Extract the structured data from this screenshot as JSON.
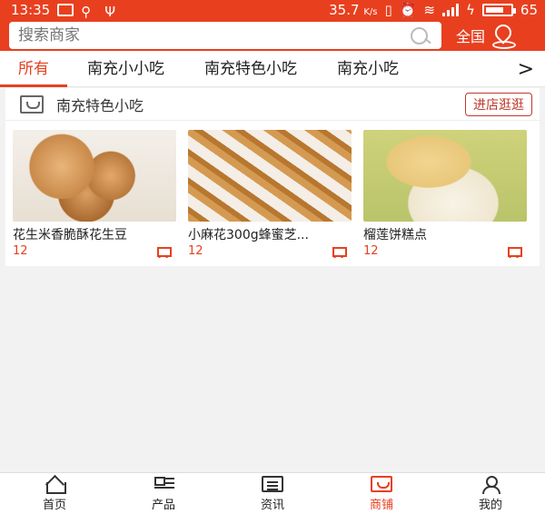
{
  "status_bar": {
    "time": "13:35",
    "speed": "35.7",
    "speed_unit": "K/s",
    "battery": "65"
  },
  "search": {
    "placeholder": "搜索商家",
    "region_label": "全国"
  },
  "tabs": [
    {
      "label": "所有",
      "active": true
    },
    {
      "label": "南充小小吃",
      "active": false
    },
    {
      "label": "南充特色小吃",
      "active": false
    },
    {
      "label": "南充小吃",
      "active": false
    }
  ],
  "tab_more_glyph": ">",
  "shop": {
    "name": "南充特色小吃",
    "visit_label": "进店逛逛",
    "products": [
      {
        "name": "花生米香脆酥花生豆",
        "price": "12"
      },
      {
        "name": "小麻花300g蜂蜜芝...",
        "price": "12"
      },
      {
        "name": "榴莲饼糕点",
        "price": "12"
      }
    ]
  },
  "bottom_nav": [
    {
      "label": "首页",
      "active": false
    },
    {
      "label": "产品",
      "active": false
    },
    {
      "label": "资讯",
      "active": false
    },
    {
      "label": "商铺",
      "active": true
    },
    {
      "label": "我的",
      "active": false
    }
  ],
  "colors": {
    "brand": "#e8401f",
    "price": "#e8401f"
  }
}
